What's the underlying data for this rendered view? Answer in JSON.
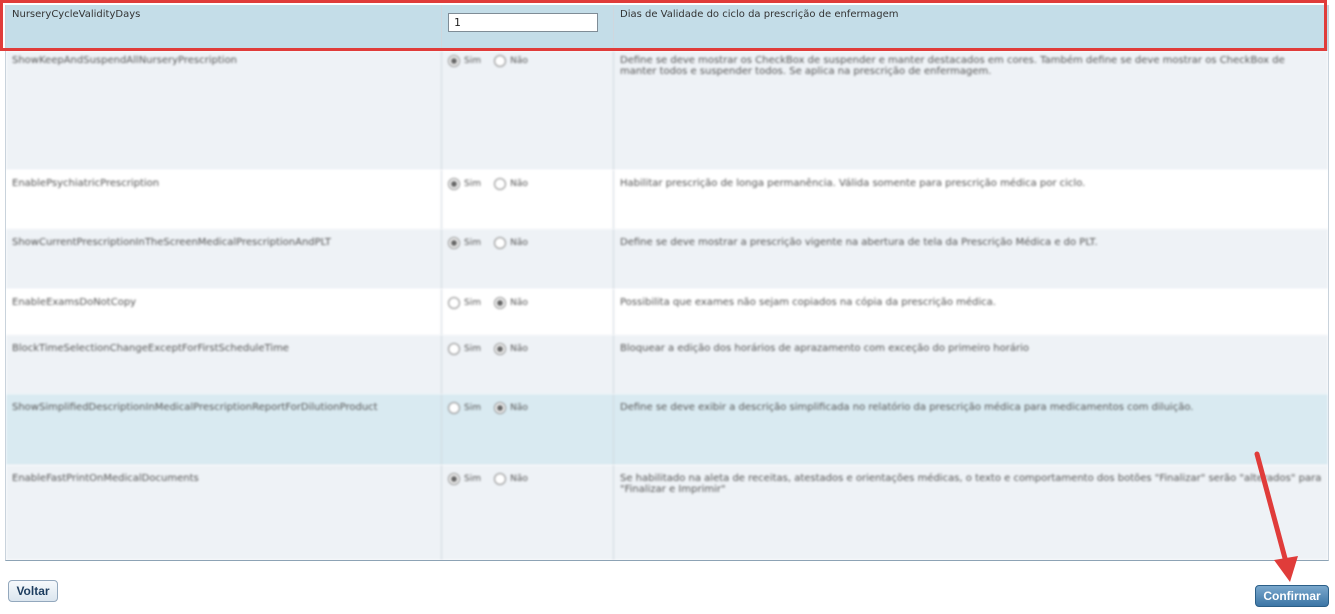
{
  "rows": [
    {
      "name": "NurseryCycleValidityDays",
      "type": "input",
      "value": "1",
      "description": "Dias de Validade do ciclo da prescrição de enfermagem"
    },
    {
      "name": "ShowKeepAndSuspendAllNurseryPrescription",
      "type": "radio",
      "selected": "sim",
      "description": "Define se deve mostrar os CheckBox de suspender e manter destacados em cores. Também define se deve mostrar os CheckBox de manter todos e suspender todos. Se aplica na prescrição de enfermagem."
    },
    {
      "name": "EnablePsychiatricPrescription",
      "type": "radio",
      "selected": "sim",
      "description": "Habilitar prescrição de longa permanência. Válida somente para prescrição médica por ciclo."
    },
    {
      "name": "ShowCurrentPrescriptionInTheScreenMedicalPrescriptionAndPLT",
      "type": "radio",
      "selected": "sim",
      "description": "Define se deve mostrar a prescrição vigente na abertura de tela da Prescrição Médica e do PLT."
    },
    {
      "name": "EnableExamsDoNotCopy",
      "type": "radio",
      "selected": "nao",
      "description": "Possibilita que exames não sejam copiados na cópia da prescrição médica."
    },
    {
      "name": "BlockTimeSelectionChangeExceptForFirstScheduleTime",
      "type": "radio",
      "selected": "nao",
      "description": "Bloquear a edição dos horários de aprazamento com exceção do primeiro horário"
    },
    {
      "name": "ShowSimplifiedDescriptionInMedicalPrescriptionReportForDilutionProduct",
      "type": "radio",
      "selected": "nao",
      "description": "Define se deve exibir a descrição simplificada no relatório da prescrição médica para medicamentos com diluição."
    },
    {
      "name": "EnableFastPrintOnMedicalDocuments",
      "type": "radio",
      "selected": "sim",
      "description": "Se habilitado na aleta de receitas, atestados e orientações médicas, o texto e comportamento dos botões \"Finalizar\" serão \"alterados\" para \"Finalizar e Imprimir\""
    }
  ],
  "radio_labels": {
    "sim": "Sim",
    "nao": "Não"
  },
  "buttons": {
    "back": "Voltar",
    "confirm": "Confirmar"
  },
  "colors": {
    "highlight": "#e03c3a",
    "confirm": "#3c76a6"
  }
}
